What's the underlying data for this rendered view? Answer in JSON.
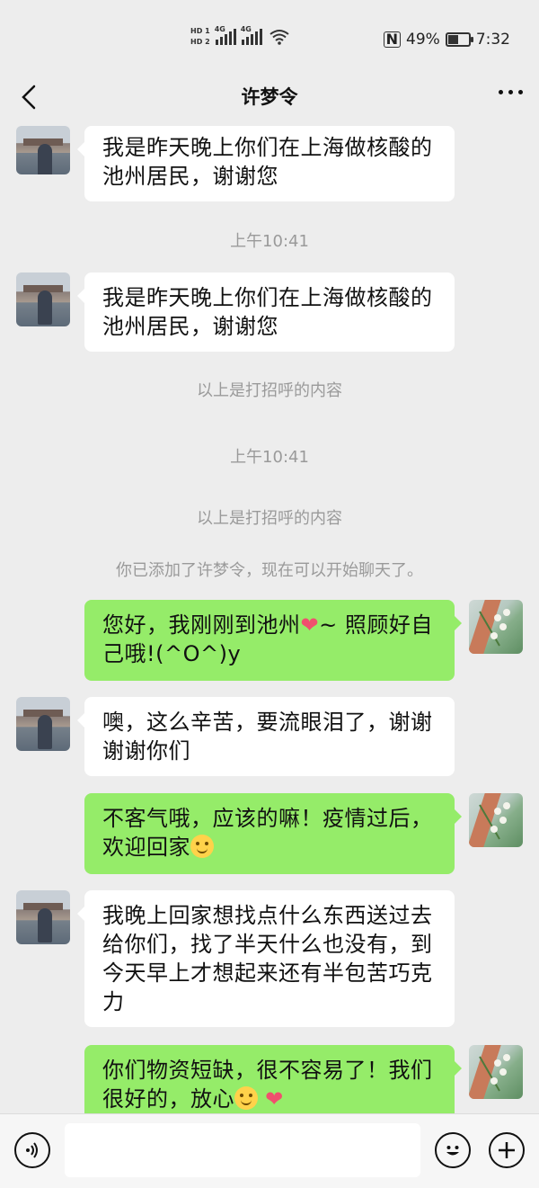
{
  "status_bar": {
    "hd1": "HD 1",
    "hd2": "HD 2",
    "net1": "4G",
    "net2": "4G",
    "nfc": "N",
    "battery_text": "49%",
    "battery_level": 0.49,
    "time": "7:32"
  },
  "header": {
    "title": "许梦令",
    "back_icon": "back-chevron-icon",
    "more_icon": "more-dots-icon"
  },
  "messages": [
    {
      "from": "them",
      "lines": [
        "我是昨天晚上你们在上海做核酸的",
        "池州居民，谢谢您"
      ]
    },
    {
      "from": "system",
      "text": "上午10:41"
    },
    {
      "from": "them",
      "lines": [
        "我是昨天晚上你们在上海做核酸的",
        "池州居民，谢谢您"
      ]
    },
    {
      "from": "system",
      "text": "以上是打招呼的内容"
    },
    {
      "from": "system",
      "text": "上午10:41"
    },
    {
      "from": "system",
      "text": "以上是打招呼的内容"
    },
    {
      "from": "system",
      "text": "你已添加了许梦令，现在可以开始聊天了。"
    },
    {
      "from": "me",
      "line1a": "您好，我刚刚到池州",
      "line1b": "~ 照顾好自",
      "line2": "己哦!(^O^)y"
    },
    {
      "from": "them",
      "lines": [
        "噢，这么辛苦，要流眼泪了，谢谢",
        "谢谢你们"
      ]
    },
    {
      "from": "me",
      "line1": "不客气哦，应该的嘛！疫情过后，",
      "line2": "欢迎回家"
    },
    {
      "from": "them",
      "lines": [
        "我晚上回家想找点什么东西送过去",
        "给你们，找了半天什么也没有，到",
        "今天早上才想起来还有半包苦巧克",
        "力"
      ]
    },
    {
      "from": "me",
      "line1": "你们物资短缺，很不容易了！我们",
      "line2": "很好的，放心"
    }
  ],
  "input_bar": {
    "voice_icon": "voice-icon",
    "emoji_icon": "emoji-icon",
    "plus_icon": "plus-icon",
    "input_value": ""
  },
  "colors": {
    "background": "#ededed",
    "my_bubble": "#95ec69",
    "their_bubble": "#ffffff",
    "system_text": "#9a9a9a"
  }
}
